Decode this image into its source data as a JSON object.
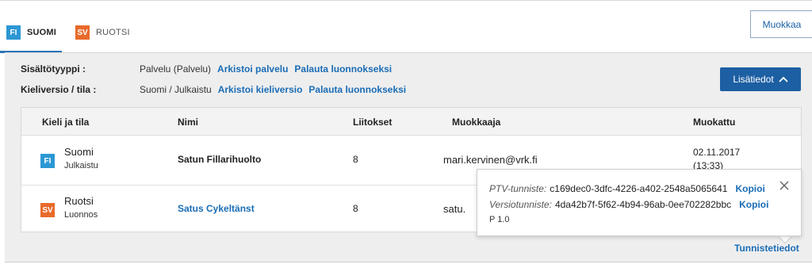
{
  "tabs": [
    {
      "code": "FI",
      "label": "SUOMI",
      "color": "#2c97d4",
      "active": true
    },
    {
      "code": "SV",
      "label": "RUOTSI",
      "color": "#e86a2a",
      "active": false
    }
  ],
  "header": {
    "edit_label": "Muokkaa"
  },
  "meta": {
    "content_type": {
      "label": "Sisältötyyppi :",
      "value": "Palvelu (Palvelu)",
      "links": [
        "Arkistoi palvelu",
        "Palauta luonnokseksi"
      ]
    },
    "language_version": {
      "label": "Kieliversio / tila :",
      "value": "Suomi / Julkaistu",
      "links": [
        "Arkistoi kieliversio",
        "Palauta luonnokseksi"
      ]
    },
    "more_info_label": "Lisätiedot"
  },
  "table": {
    "headers": [
      "Kieli ja tila",
      "Nimi",
      "Liitokset",
      "Muokkaaja",
      "Muokattu"
    ],
    "rows": [
      {
        "lang_code": "FI",
        "lang_name": "Suomi",
        "status": "Julkaistu",
        "name": "Satun Fillarihuolto",
        "connections": "8",
        "editor": "mari.kervinen@vrk.fi",
        "modified_date": "02.11.2017",
        "modified_time": "(13:33)"
      },
      {
        "lang_code": "SV",
        "lang_name": "Ruotsi",
        "status": "Luonnos",
        "name": "Satus Cykeltänst",
        "connections": "8",
        "editor": "satu.",
        "modified_date": "",
        "modified_time": ""
      }
    ]
  },
  "popup": {
    "ptv_label": "PTV-tunniste:",
    "ptv_value": "c169dec0-3dfc-4226-a402-2548a5065641",
    "version_label": "Versiotunniste:",
    "version_value": "4da42b7f-5f62-4b94-96ab-0ee702282bbc",
    "copy_label": "Kopioi",
    "version_number": "P 1.0"
  },
  "footer": {
    "identifiers_link": "Tunnistetiedot"
  },
  "colors": {
    "link": "#1a6cb5",
    "primary_button": "#1d5fa3",
    "fi_badge": "#2c97d4",
    "sv_badge": "#e86a2a"
  }
}
